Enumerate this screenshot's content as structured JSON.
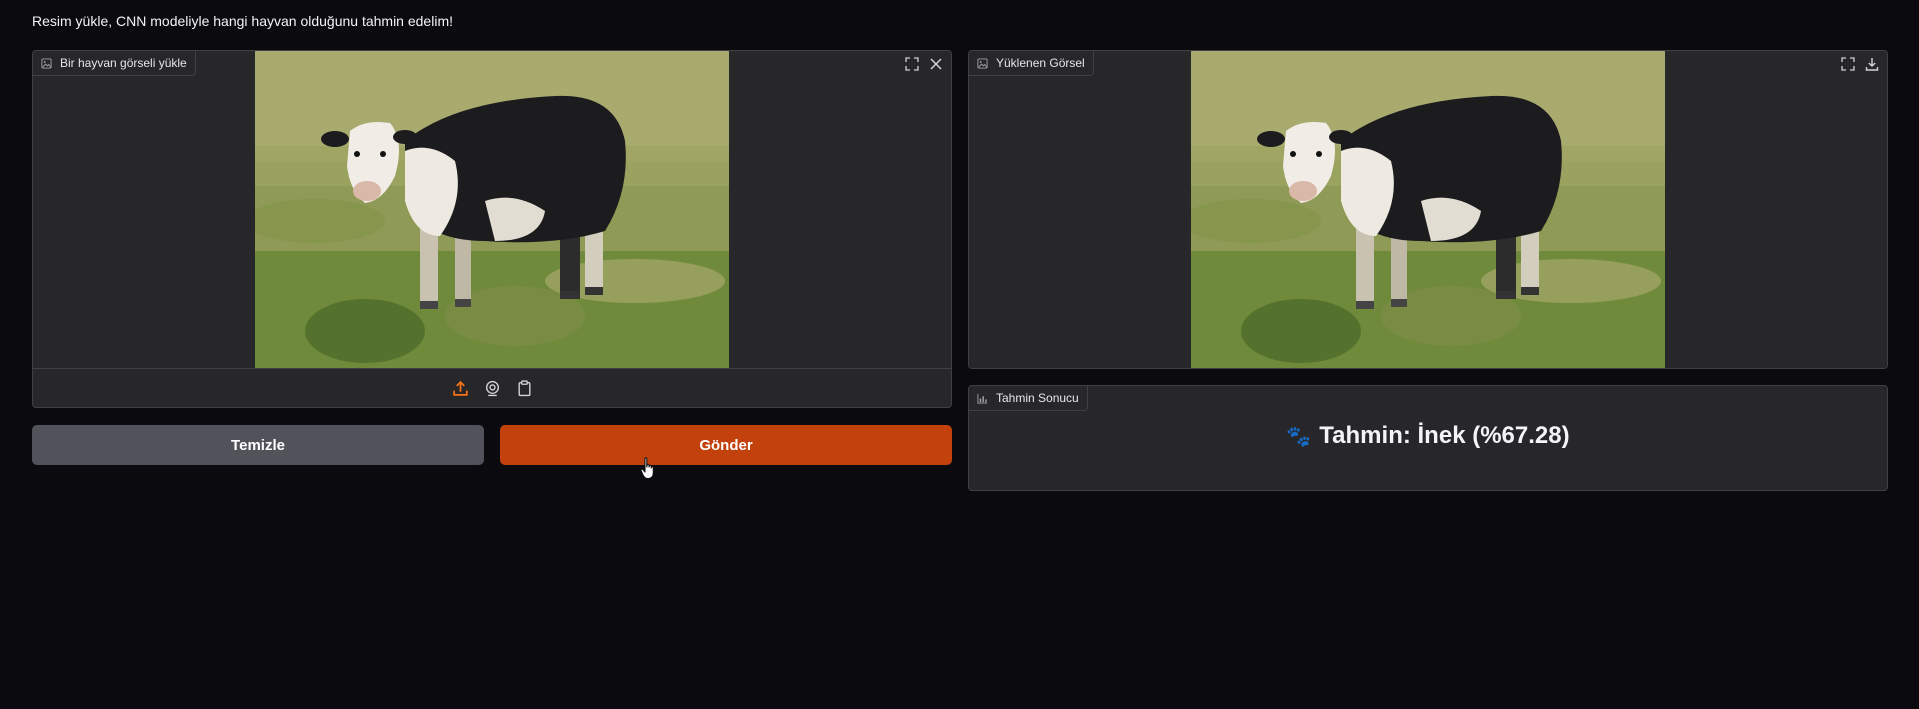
{
  "description": "Resim yükle, CNN modeliyle hangi hayvan olduğunu tahmin edelim!",
  "input_panel": {
    "label": "Bir hayvan görseli yükle",
    "label_icon": "image-icon",
    "corner_buttons": [
      "fullscreen-icon",
      "close-icon"
    ],
    "sources": [
      "upload-icon",
      "webcam-icon",
      "clipboard-icon"
    ],
    "image_subject": "black-and-white cow in grass field"
  },
  "buttons": {
    "clear_label": "Temizle",
    "submit_label": "Gönder"
  },
  "output_image_panel": {
    "label": "Yüklenen Görsel",
    "label_icon": "image-icon",
    "corner_buttons": [
      "fullscreen-icon",
      "download-icon"
    ]
  },
  "result_panel": {
    "label": "Tahmin Sonucu",
    "label_icon": "bar-chart-icon",
    "emoji": "🐾",
    "text": "Tahmin: İnek (%67.28)"
  },
  "colors": {
    "background": "#0b0b0f",
    "panel": "#27272a",
    "border": "#3f3f46",
    "accent": "#c2410c",
    "secondary_button": "#52525b",
    "upload_icon": "#f97316"
  }
}
